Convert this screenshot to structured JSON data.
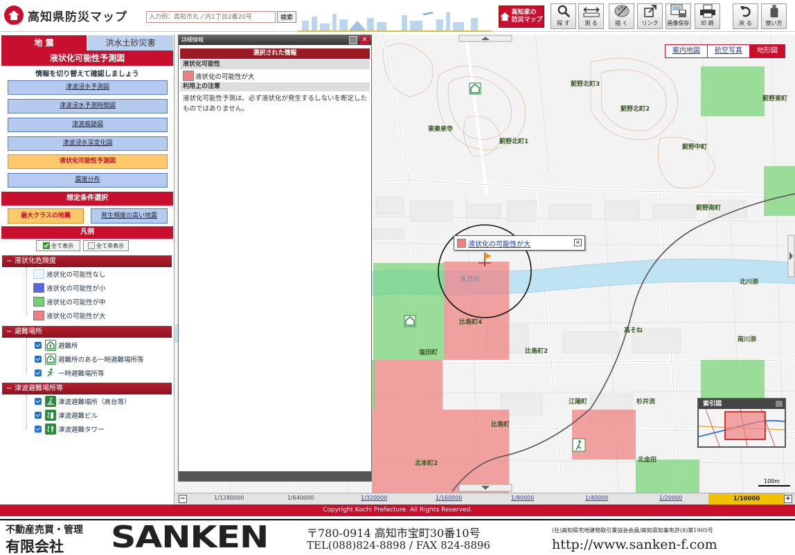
{
  "header": {
    "title": "高知県防災マップ",
    "search_placeholder": "入力例：高知市丸ノ内1丁目2番20号",
    "search_button": "検索",
    "home_map_line1": "高知家の",
    "home_map_line2": "防災マップ",
    "tools": [
      {
        "label": "探 す",
        "icon": "magnifier-icon"
      },
      {
        "label": "測 る",
        "icon": "ruler-icon"
      },
      {
        "label": "描 く",
        "icon": "palette-icon"
      },
      {
        "label": "リンク",
        "icon": "link-icon"
      },
      {
        "label": "画像保存",
        "icon": "save-image-icon"
      },
      {
        "label": "印 刷",
        "icon": "printer-icon"
      },
      {
        "label": "戻 る",
        "icon": "back-icon"
      },
      {
        "label": "使い方",
        "icon": "help-icon"
      }
    ]
  },
  "sidebar": {
    "tab_quake": "地 震",
    "tab_flood": "洪水土砂災害",
    "title": "液状化可能性予測図",
    "subtitle": "情報を切り替えて確認しましょう",
    "map_buttons": [
      {
        "label": "津波浸水予測図",
        "active": false
      },
      {
        "label": "津波浸水予測時間図",
        "active": false
      },
      {
        "label": "津波痕跡図",
        "active": false
      },
      {
        "label": "津波浸水深変化図",
        "active": false
      },
      {
        "label": "液状化可能性予測図",
        "active": true
      },
      {
        "label": "震度分布",
        "active": false
      }
    ],
    "condition_header": "想定条件選択",
    "condition_max": "最大クラスの地震",
    "condition_freq": "発生頻度の高い地震",
    "legend_header": "凡例",
    "show_all": "全て表示",
    "hide_all": "全て非表示",
    "groups": {
      "liquefaction": {
        "title": "液状化危険度",
        "items": [
          {
            "label": "液状化の可能性なし",
            "color": "#eaf6fb"
          },
          {
            "label": "液状化の可能性が小",
            "color": "#5a66e6"
          },
          {
            "label": "液状化の可能性が中",
            "color": "#6fd36f"
          },
          {
            "label": "液状化の可能性が大",
            "color": "#f08080"
          }
        ]
      },
      "shelters": {
        "title": "避難場所",
        "items": [
          {
            "label": "避難所",
            "icon": "shelter-icon"
          },
          {
            "label": "避難所のある一時避難場所等",
            "icon": "shelter-temporary-icon"
          },
          {
            "label": "一時避難場所等",
            "icon": "evacuation-runner-icon"
          }
        ]
      },
      "tsunami": {
        "title": "津波避難場所等",
        "items": [
          {
            "label": "津波避難場所（高台等）",
            "icon": "tsunami-high-ground-icon"
          },
          {
            "label": "津波避難ビル",
            "icon": "tsunami-building-icon"
          },
          {
            "label": "津波避難タワー",
            "icon": "tsunami-tower-icon"
          }
        ]
      }
    }
  },
  "detail": {
    "window_title": "詳細情報",
    "header": "選択された情報",
    "label1": "液状化可能性",
    "value1": "液状化の可能性が大",
    "label2": "利用上の注意",
    "note": "液状化可能性予測は、必ず液状化が発生するしないを断定したものではありません。"
  },
  "map": {
    "types": [
      {
        "label": "案内地図",
        "active": false
      },
      {
        "label": "航空写真",
        "active": false
      },
      {
        "label": "地形図",
        "active": true
      }
    ],
    "popup_text": "液状化の可能性が大",
    "overview_title": "索引図",
    "scale_label": "100m",
    "place_names": [
      {
        "text": "薊野北町3"
      },
      {
        "text": "薊野北町2"
      },
      {
        "text": "薊野北町1"
      },
      {
        "text": "薊野東町"
      },
      {
        "text": "薊野中町"
      },
      {
        "text": "薊野南町"
      },
      {
        "text": "東秦泉寺"
      },
      {
        "text": "比島町4"
      },
      {
        "text": "比島町2"
      },
      {
        "text": "北川添"
      },
      {
        "text": "高そね"
      },
      {
        "text": "南川添"
      },
      {
        "text": "塩田町"
      },
      {
        "text": "江陽町"
      },
      {
        "text": "杉井流"
      },
      {
        "text": "北本町2"
      },
      {
        "text": "北金田"
      },
      {
        "text": "比島町"
      },
      {
        "text": "久万川"
      }
    ]
  },
  "scales": {
    "items": [
      "1/1280000",
      "1/640000",
      "1/320000",
      "1/160000",
      "1/80000",
      "1/40000",
      "1/20000"
    ],
    "active": "1/10000"
  },
  "copyright": "Copyright Kochi Prefecture. All Rights Reserved.",
  "ad": {
    "line1": "不動産売買・管理",
    "line2": "有限会社",
    "brand": "SANKEN",
    "address": "〒780-0914 高知市宝町30番10号",
    "phone": "TEL(088)824-8898 / FAX 824-8896",
    "license": "(社)高知県宅地建物取引業協会会員/高知県知事免許(8)第1905号",
    "url": "http://www.sanken-f.com"
  },
  "colors": {
    "brand_red": "#c8102e",
    "active_orange": "#ffc96b",
    "button_blue": "#b4cbef",
    "risk_high": "#f08080",
    "risk_mid": "#6fd36f"
  }
}
